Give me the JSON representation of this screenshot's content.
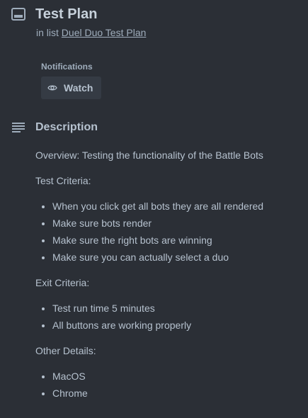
{
  "card": {
    "title": "Test Plan",
    "in_list_prefix": "in list",
    "list_name": "Duel Duo Test Plan"
  },
  "notifications": {
    "label": "Notifications",
    "watch_label": "Watch"
  },
  "description": {
    "heading": "Description",
    "overview": "Overview: Testing the functionality of the Battle Bots",
    "test_criteria_label": "Test Criteria:",
    "test_criteria": [
      "When you click get all bots they are all rendered",
      "Make sure bots render",
      "Make sure the right bots are winning",
      "Make sure you can actually select a duo"
    ],
    "exit_criteria_label": "Exit Criteria:",
    "exit_criteria": [
      "Test run time 5 minutes",
      "All buttons are working properly"
    ],
    "other_details_label": "Other Details:",
    "other_details": [
      "MacOS",
      "Chrome"
    ]
  },
  "colors": {
    "background": "#2b2f36",
    "text": "#b6c2cf",
    "muted": "#9fadbc",
    "button_bg": "#353b44"
  },
  "icons": {
    "card": "card-icon",
    "watch": "eye-icon",
    "description": "description-lines-icon"
  }
}
